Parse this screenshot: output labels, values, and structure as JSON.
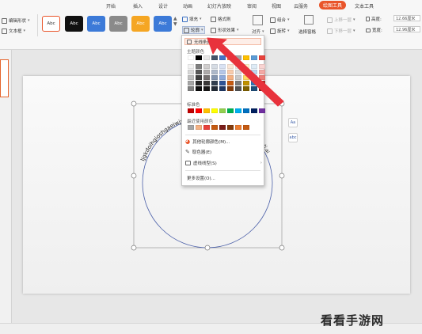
{
  "tabs": [
    "开始",
    "插入",
    "设计",
    "动画",
    "幻灯片放映",
    "审阅",
    "视图",
    "云服务",
    "绘图工具",
    "文本工具"
  ],
  "active_tab": "绘图工具",
  "ribbon": {
    "edit_shape": "编辑形状",
    "text_box": "文本框",
    "style_labels": [
      "Abc",
      "Abc",
      "Abc",
      "Abc",
      "Abc",
      "Abc"
    ],
    "style_colors": [
      "#ffffff",
      "#111111",
      "#3c7ad8",
      "#8a8a8a",
      "#f5a623",
      "#3c7ad8"
    ],
    "fill": "填充",
    "format_painter": "格式刷",
    "outline": "轮廓",
    "shape_effects": "形状效果",
    "align": "对齐",
    "group": "组合",
    "rotate": "旋转",
    "selection_pane": "选择窗格",
    "bring_forward": "上移一层",
    "send_backward": "下移一层",
    "height_label": "高度:",
    "height_value": "12.66厘米",
    "width_label": "宽度:",
    "width_value": "12.96厘米"
  },
  "dropdown": {
    "no_outline": "无线条颜色",
    "theme_colors_label": "主题颜色",
    "standard_colors_label": "标准色",
    "recent_colors_label": "最近使用颜色",
    "more_outline_colors": "其他轮廓颜色(M)...",
    "eyedropper": "取色器(E)",
    "dash_type": "虚线线型(S)",
    "more_settings": "更多设置(O)...",
    "theme_top_row": [
      "#ffffff",
      "#000000",
      "#e7e6e6",
      "#44546a",
      "#4472c4",
      "#ed7d31",
      "#a5a5a5",
      "#ffc000",
      "#5b9bd5",
      "#e8423c"
    ],
    "theme_shade_rows": [
      [
        "#f2f2f2",
        "#7f7f7f",
        "#d0cece",
        "#d6dce4",
        "#d9e2f3",
        "#fbe5d5",
        "#ededed",
        "#fff2cc",
        "#deebf6",
        "#f9d4d2"
      ],
      [
        "#d8d8d8",
        "#595959",
        "#aeabab",
        "#adb9ca",
        "#b4c6e7",
        "#f7cbac",
        "#dbdbdb",
        "#fee599",
        "#bdd7ee",
        "#f3a9a5"
      ],
      [
        "#bfbfbf",
        "#3f3f3f",
        "#757070",
        "#8496b0",
        "#8eaadb",
        "#f4b183",
        "#c9c9c9",
        "#ffd965",
        "#9cc3e5",
        "#ee7e78"
      ],
      [
        "#a5a5a5",
        "#262626",
        "#3a3838",
        "#323f4f",
        "#2f5496",
        "#c55a11",
        "#7b7b7b",
        "#bf9000",
        "#2e75b5",
        "#b72c26"
      ],
      [
        "#7f7f7f",
        "#0c0c0c",
        "#171616",
        "#222a35",
        "#1f3864",
        "#833c0b",
        "#525252",
        "#7f6000",
        "#1e4e79",
        "#7a1e1a"
      ]
    ],
    "standard_colors": [
      "#c00000",
      "#ff0000",
      "#ffc000",
      "#ffff00",
      "#92d050",
      "#00b050",
      "#00b0f0",
      "#0070c0",
      "#002060",
      "#7030a0"
    ],
    "recent_colors": [
      "#a5a5a5",
      "#f4b183",
      "#e8423c",
      "#c55a11",
      "#7a1e1a",
      "#843c0c",
      "#ed7d31",
      "#c55a11"
    ]
  },
  "slide": {
    "curved_text": "ljgkdoihgioshgaeiwjyt",
    "curved_text_right": "ti.ai"
  },
  "side_buttons": [
    "Aa",
    "abc"
  ],
  "watermark": "看看手游网",
  "colors": {
    "accent": "#e9552a",
    "arrow": "#e8323c",
    "circle": "#4a5fa8"
  }
}
